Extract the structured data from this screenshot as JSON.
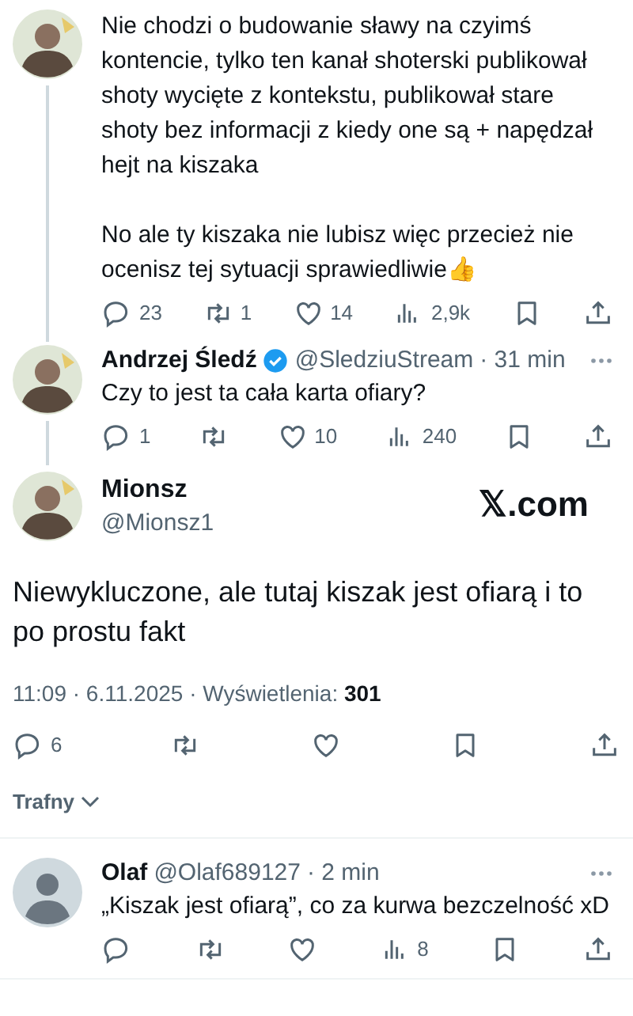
{
  "replies_top": [
    {
      "paragraphs": [
        "Nie chodzi o budowanie sławy na czyimś kontencie, tylko ten kanał shoterski publikował shoty wycięte z kontekstu, publikował stare shoty bez informacji z kiedy one są + napędzał hejt na kiszaka",
        "No ale ty kiszaka nie lubisz więc przecież nie ocenisz tej sytuacji sprawiedliwie👍"
      ],
      "actions": [
        {
          "kind": "reply",
          "count": "23"
        },
        {
          "kind": "retweet",
          "count": "1"
        },
        {
          "kind": "like",
          "count": "14"
        },
        {
          "kind": "views",
          "count": "2,9k"
        },
        {
          "kind": "bookmark"
        },
        {
          "kind": "share"
        }
      ]
    },
    {
      "author": {
        "name": "Andrzej Śledź",
        "verified": true,
        "handle": "@SledziuStream",
        "time": "· 31 min"
      },
      "paragraphs": [
        "Czy to jest ta cała karta ofiary?"
      ],
      "actions": [
        {
          "kind": "reply",
          "count": "1"
        },
        {
          "kind": "retweet"
        },
        {
          "kind": "like",
          "count": "10"
        },
        {
          "kind": "views",
          "count": "240"
        },
        {
          "kind": "bookmark"
        },
        {
          "kind": "share"
        }
      ]
    }
  ],
  "main_tweet": {
    "name": "Mionsz",
    "handle": "@Mionsz1",
    "site": "𝕏.com",
    "text": "Niewykluczone, ale tutaj kiszak jest ofiarą i to po prostu fakt",
    "meta": "11:09 · 6.11.2025 · Wyświetlenia: **301**",
    "actions": [
      {
        "kind": "reply",
        "count": "6"
      },
      {
        "kind": "retweet"
      },
      {
        "kind": "like"
      },
      {
        "kind": "bookmark"
      },
      {
        "kind": "share"
      }
    ]
  },
  "sort": {
    "label": "Trafny"
  },
  "replies": [
    {
      "author": {
        "name": "Olaf",
        "handle": "@Olaf689127",
        "time": "· 2 min"
      },
      "paragraphs": [
        "„Kiszak jest ofiarą”, co za kurwa bezczelność xD"
      ],
      "actions": [
        {
          "kind": "reply"
        },
        {
          "kind": "retweet"
        },
        {
          "kind": "like"
        },
        {
          "kind": "views",
          "count": "8"
        },
        {
          "kind": "bookmark"
        },
        {
          "kind": "share"
        }
      ]
    }
  ]
}
